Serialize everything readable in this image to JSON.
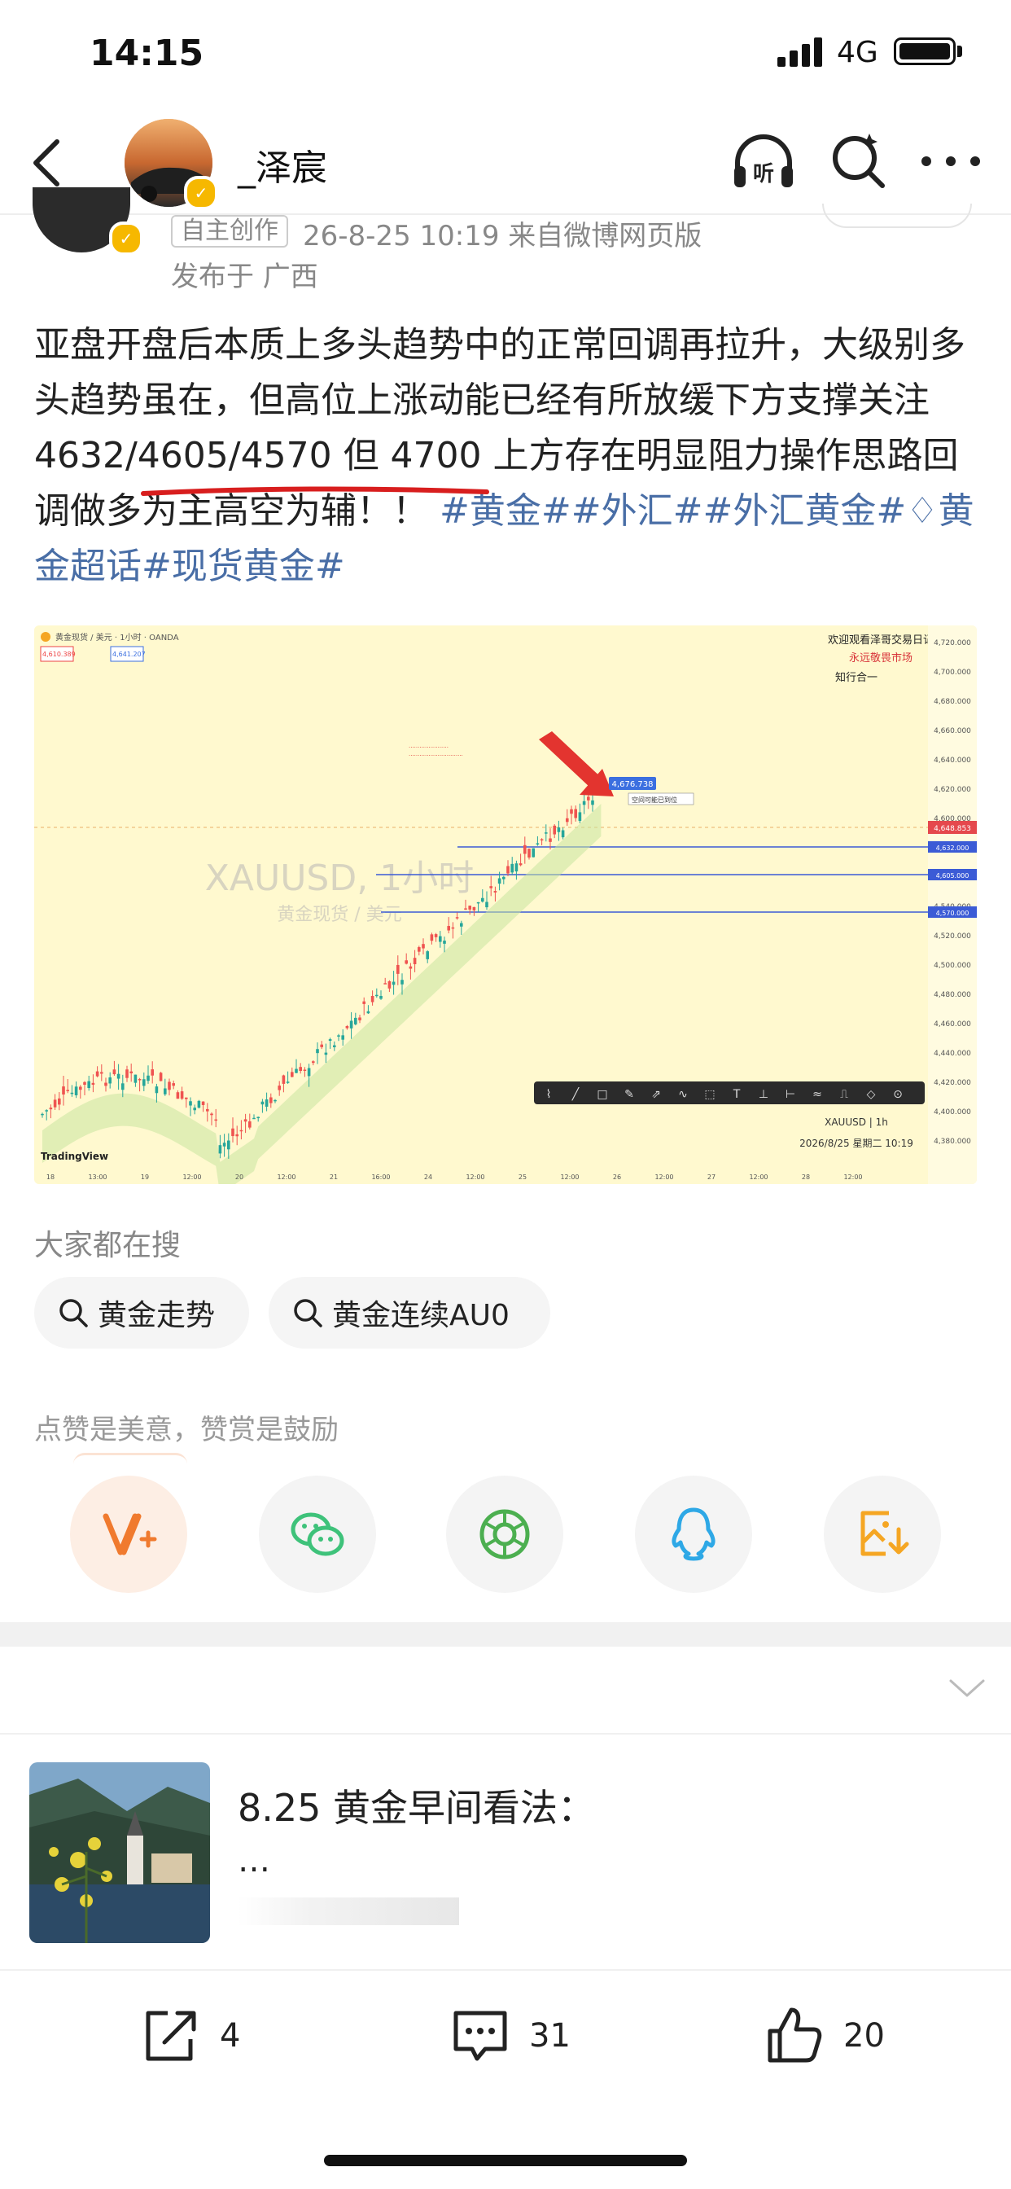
{
  "status_bar": {
    "time": "14:15",
    "network": "4G"
  },
  "header": {
    "username": "_泽宸"
  },
  "meta": {
    "tag": "自主创作",
    "time_source": "26-8-25 10:19  来自微博网页版",
    "location": "发布于 广西"
  },
  "post": {
    "text": "亚盘开盘后本质上多头趋势中的正常回调再拉升，大级别多头趋势虽在，但高位上涨动能已经有所放缓下方支撑关注 4632/4605/4570 但 4700 上方存在明显阻力操作思路回调做多为主高空为辅！！ ",
    "tags": "#黄金##外汇##外汇黄金#",
    "supertopic_tag": "黄金超话",
    "tag_end": "#现货黄金#"
  },
  "chart_image": {
    "watermark_symbol": "XAUUSD, 1小时",
    "watermark_name": "黄金现货 / 美元",
    "title_small": "黄金现货 / 美元 · 1小时 · OANDA",
    "top_right_1": "欢迎观看泽哥交易日记",
    "top_right_2": "永远敬畏市场",
    "top_right_3": "知行合一",
    "callout": "4,676.738",
    "callout_note": "空间可能已到位",
    "footer_symbol": "XAUUSD | 1h",
    "footer_date": "2026/8/25 星期二 10:19",
    "brand": "TradingView",
    "price_axis": [
      "4,720.000",
      "4,700.000",
      "4,680.000",
      "4,660.000",
      "4,640.000",
      "4,620.000",
      "4,600.000",
      "4,580.000",
      "4,560.000",
      "4,540.000",
      "4,520.000",
      "4,500.000",
      "4,480.000",
      "4,460.000",
      "4,440.000",
      "4,420.000",
      "4,400.000",
      "4,380.000"
    ],
    "level_labels": [
      "4,632.000",
      "4,605.000",
      "4,570.000"
    ],
    "current_price": "4,648.853",
    "box_left": "4,610.389",
    "box_right": "4,641.207",
    "time_axis": [
      "18",
      "13:00",
      "19",
      "12:00",
      "20",
      "12:00",
      "21",
      "16:00",
      "24",
      "12:00",
      "25",
      "12:00",
      "26",
      "12:00",
      "27",
      "12:00",
      "28",
      "12:00"
    ]
  },
  "search": {
    "heading": "大家都在搜",
    "chips": [
      "黄金走势",
      "黄金连续AU0"
    ]
  },
  "like_tip": "点赞是美意，赞赏是鼓励",
  "share_icons": [
    "reward-icon",
    "wechat-icon",
    "moments-icon",
    "qq-icon",
    "save-image-icon"
  ],
  "related": {
    "title": "8.25 黄金早间看法：",
    "ellipsis": "…"
  },
  "actions": {
    "share_count": "4",
    "comment_count": "31",
    "like_count": "20"
  },
  "colors": {
    "tag_blue": "#496ea6",
    "reward_orange": "#f07a2e",
    "wechat_green": "#3ec27a",
    "moments_green": "#4caf50",
    "qq_blue": "#2ea8e6",
    "save_orange": "#f5a623",
    "chart_bg": "#fff9cf",
    "underline_red": "#d81e1e"
  }
}
